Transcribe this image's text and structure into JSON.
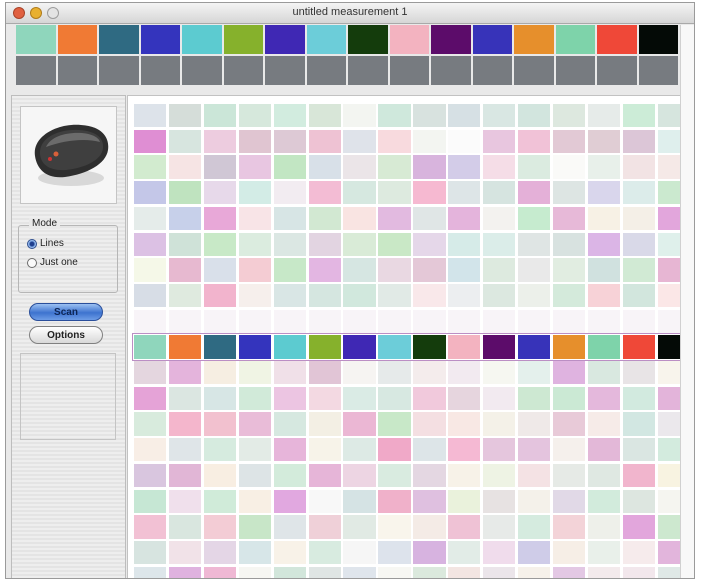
{
  "window": {
    "title": "untitled measurement 1"
  },
  "reference": {
    "colors": [
      "#8fd6bc",
      "#f07a34",
      "#2f6a82",
      "#3434bd",
      "#5ccbd0",
      "#86b12c",
      "#3f28b4",
      "#6ccdd9",
      "#143c0c",
      "#f3b3c0",
      "#5c0c6a",
      "#3733b9",
      "#e68f2c",
      "#7ed3aa",
      "#ef4838",
      "#040a06"
    ],
    "gray": "#777b80"
  },
  "sidebar": {
    "device_icon": "colorimeter-device-icon",
    "mode_label": "Mode",
    "options": [
      {
        "label": "Lines",
        "selected": true
      },
      {
        "label": "Just one",
        "selected": false
      }
    ],
    "scan_label": "Scan",
    "options_label": "Options"
  },
  "measured": {
    "highlight_row": 9,
    "highlight_color": "#bb8ec4",
    "rows": [
      [
        "#dde3ea",
        "#d5ddd9",
        "#cbe6d8",
        "#d6e8dc",
        "#d2ecdf",
        "#d8e6d8",
        "#f3f5f1",
        "#cfe8dc",
        "#d8e2df",
        "#d6e0e4",
        "#d9e7e3",
        "#d2e5de",
        "#dde8df",
        "#e6ebe9",
        "#ccecd7",
        "#d6e5de"
      ],
      [
        "#df8ed3",
        "#d7e5df",
        "#edccdf",
        "#e0c5d1",
        "#ddc9d5",
        "#eec2d3",
        "#dfe3ea",
        "#f8dade",
        "#f3f5f1",
        "#fbfbfb",
        "#e8c6df",
        "#f1c2d7",
        "#e2c9d5",
        "#e0cdd4",
        "#dcc6d7",
        "#dfefed"
      ],
      [
        "#d2ebcf",
        "#f6e4e4",
        "#d0c7d5",
        "#e8c6e1",
        "#c2e6c3",
        "#d8e0e8",
        "#ebe5e8",
        "#d7ead4",
        "#d8b4dd",
        "#d3cce8",
        "#f5dde7",
        "#dbebe0",
        "#fafaf8",
        "#e8f0ea",
        "#f2e3e4",
        "#f5e9e7"
      ],
      [
        "#c4c7e8",
        "#bfe3bf",
        "#e7d9ea",
        "#d3ece6",
        "#f2ecf1",
        "#f3bcd4",
        "#d6e8e0",
        "#ddeadf",
        "#f6b9d1",
        "#dde5e7",
        "#d6e4e0",
        "#e4b0d8",
        "#dde5e3",
        "#d9d6ec",
        "#dcecea",
        "#cbe9cf"
      ],
      [
        "#e5ecea",
        "#c7d0ea",
        "#e8a8d8",
        "#f8e4e7",
        "#d7e5e5",
        "#d2e8d2",
        "#f9e4e2",
        "#e2bae0",
        "#e0e6e6",
        "#e4b4dc",
        "#f3f2ef",
        "#c6ebcf",
        "#e7b9d8",
        "#f7f1e5",
        "#f4efe7",
        "#e2a6dc"
      ],
      [
        "#dcc1e4",
        "#cfe2d8",
        "#c8e9c7",
        "#dbecdf",
        "#dbe7e3",
        "#e2d4e1",
        "#d9ebd7",
        "#c9e8c6",
        "#e5d7e9",
        "#d6ebe8",
        "#dbede9",
        "#dfe5e4",
        "#d8e2e0",
        "#dbb5e6",
        "#d9d9e8",
        "#dff0eb"
      ],
      [
        "#f5f8e8",
        "#e7b9d0",
        "#d9e0ea",
        "#f4ccd3",
        "#c7e8c8",
        "#e3b6e2",
        "#d6e6e2",
        "#e9d8e2",
        "#e4c8d7",
        "#d2e4ea",
        "#ddeadf",
        "#e9e9e9",
        "#e1ede1",
        "#d0e1df",
        "#d1ead4",
        "#e7b6d3"
      ],
      [
        "#d7dde6",
        "#dfeadf",
        "#f2b4cd",
        "#f6efec",
        "#d9e6e5",
        "#d5e6e0",
        "#d1e8dd",
        "#e1eae6",
        "#f9e8ea",
        "#eceef0",
        "#dce8e0",
        "#ecf0ea",
        "#d4eadb",
        "#f7d2d7",
        "#d2e6dd",
        "#fbe7e7"
      ],
      [
        "#f8f4f8",
        "#f8f4f8",
        "#f8f4f8",
        "#f8f4f8",
        "#f8f4f8",
        "#f8f4f8",
        "#f8f4f8",
        "#f8f4f8",
        "#f8f4f8",
        "#f8f4f8",
        "#f8f4f8",
        "#f8f4f8",
        "#f8f4f8",
        "#f8f4f8",
        "#f8f4f8",
        "#f8f4f8"
      ],
      [
        "#8fd6bc",
        "#f07a34",
        "#2f6a82",
        "#3434bd",
        "#5ccbd0",
        "#86b12c",
        "#3f28b4",
        "#6ccdd9",
        "#143c0c",
        "#f3b3c0",
        "#5c0c6a",
        "#3733b9",
        "#e68f2c",
        "#7ed3aa",
        "#ef4838",
        "#040a06"
      ],
      [
        "#e4d6df",
        "#e4b4dc",
        "#f6eee2",
        "#f0f4e4",
        "#f0e0e8",
        "#e1c5d6",
        "#f6f4f2",
        "#e6eaea",
        "#f4ecec",
        "#f2eaf0",
        "#f6f7f1",
        "#e4f0ec",
        "#dfb3e0",
        "#d9e8e0",
        "#e8e4e6",
        "#f8f4ec"
      ],
      [
        "#e5a3d7",
        "#dbe6e1",
        "#d7e6e5",
        "#d1ead9",
        "#ecc5e2",
        "#f3d9e2",
        "#daebe5",
        "#d7e8e1",
        "#f1c9dc",
        "#e6d5de",
        "#f2eaf0",
        "#cde8d2",
        "#cbe9d4",
        "#e4b8dc",
        "#d2eadf",
        "#e3b4da"
      ],
      [
        "#d8ebdd",
        "#f4b6cc",
        "#f2c1cf",
        "#e9bcd8",
        "#d6e8e0",
        "#f3efe4",
        "#ebb7d4",
        "#c8e8c8",
        "#f4dfe2",
        "#f8e8e4",
        "#f4f1e8",
        "#efe9e8",
        "#e8cad8",
        "#f6ebe8",
        "#d2e7e2",
        "#ebe8ec"
      ],
      [
        "#f8eee6",
        "#dfe5e8",
        "#d6ebdf",
        "#e3ebe6",
        "#e7b5da",
        "#f7f3e9",
        "#ddeae5",
        "#f0a9c8",
        "#dde5e8",
        "#f5b9d3",
        "#e5c6dd",
        "#e4c4de",
        "#f5f0ec",
        "#e3b8d8",
        "#dae6e2",
        "#d3ebde"
      ],
      [
        "#d9c6df",
        "#e1b6d6",
        "#f8eee2",
        "#dde4e6",
        "#d3ebdb",
        "#e6b5d8",
        "#edd5e3",
        "#d9ebe0",
        "#e4d7e2",
        "#f7f2e8",
        "#eef3e4",
        "#f4e2e4",
        "#e6eae6",
        "#dfe8e2",
        "#f1b5cd",
        "#f8f3e1"
      ],
      [
        "#c6e7d4",
        "#f0e0ec",
        "#d0ebd9",
        "#f8efe4",
        "#e1a8e0",
        "#f8f8f8",
        "#d5e3e4",
        "#f0b1ca",
        "#dfc0e0",
        "#eaf2dc",
        "#e7e2e2",
        "#f4f1ea",
        "#e1d9e7",
        "#d2ebdc",
        "#dde6e0",
        "#f5f5f0"
      ],
      [
        "#f2c1d4",
        "#d9e6df",
        "#f3ccd5",
        "#c8e6c8",
        "#dfe5e8",
        "#efd0d8",
        "#e1eae4",
        "#f9f5ec",
        "#f4ebe6",
        "#efc2d5",
        "#e7eae8",
        "#d5ebdf",
        "#f3d3d8",
        "#eef0ea",
        "#e2a6dc",
        "#cde8cf"
      ],
      [
        "#d7e4e0",
        "#f1e2e8",
        "#e4d6e6",
        "#d7e6e8",
        "#f8f2e8",
        "#d8ebe0",
        "#f6f6f6",
        "#dde3ec",
        "#d7b3e0",
        "#e2ece7",
        "#f0dcec",
        "#cfcce8",
        "#f6eee6",
        "#e9f0ea",
        "#f6ebec",
        "#e2b5dc"
      ],
      [
        "#dde6ea",
        "#dfb2df",
        "#efb8d4",
        "#f6f6f2",
        "#d2e6db",
        "#dfe5e4",
        "#dfe5ec",
        "#f7f7f3",
        "#dbe9dd",
        "#f3e5e2",
        "#ebe5ea",
        "#f6f1ea",
        "#e3c8e4",
        "#f3eaec",
        "#f2e7ec",
        "#dfe8e6"
      ]
    ]
  }
}
